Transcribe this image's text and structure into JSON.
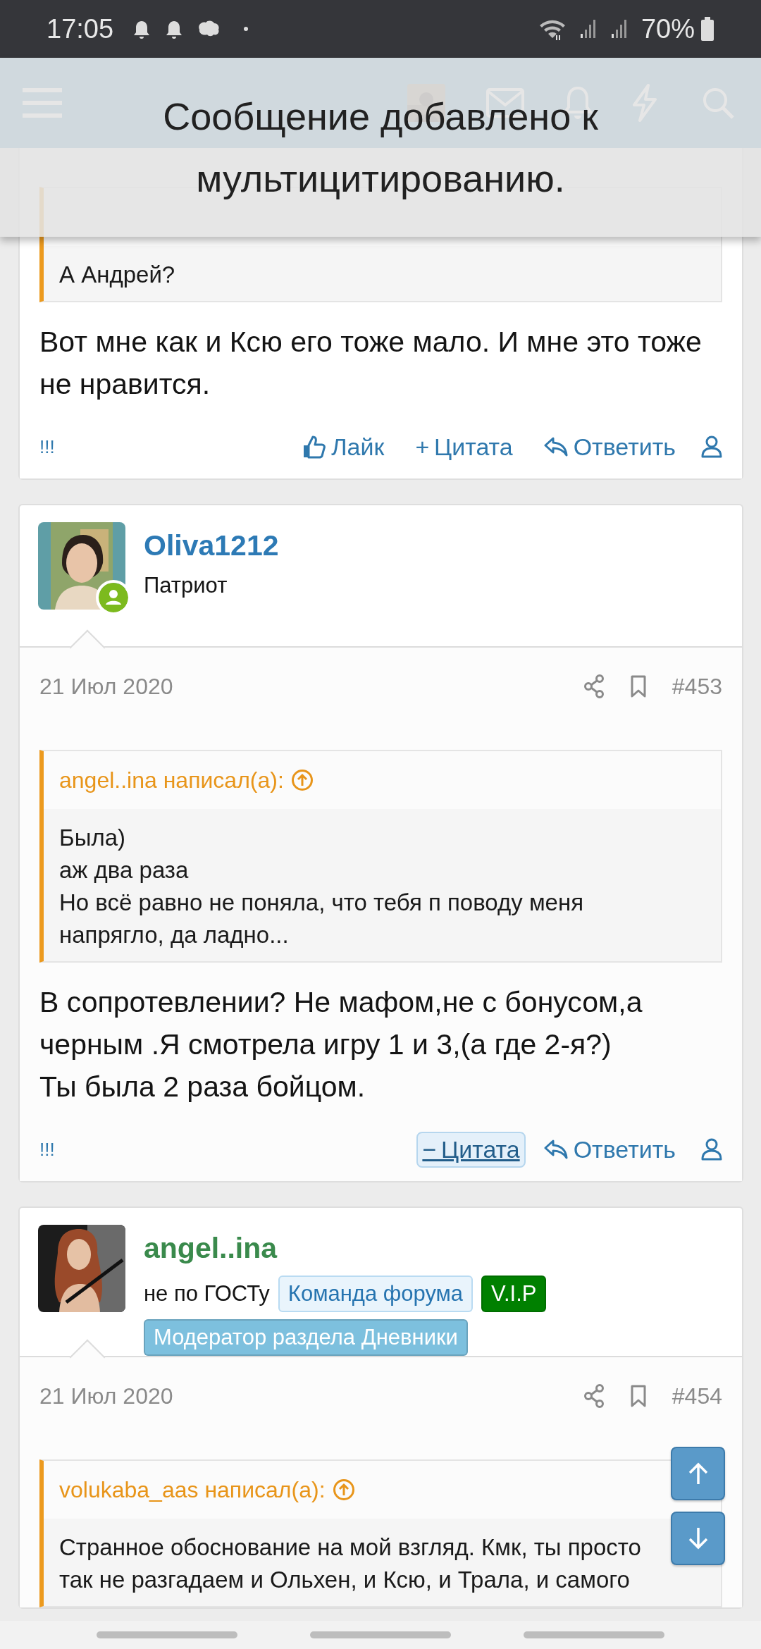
{
  "status_bar": {
    "time": "17:05",
    "battery": "70%"
  },
  "toast": {
    "message": "Сообщение добавлено к мультицитированию."
  },
  "posts": [
    {
      "quote": {
        "text": "А Андрей?"
      },
      "message": "Вот мне как и Ксю его тоже мало. И мне это тоже\nне нравится.",
      "actions": {
        "flag": "!!!",
        "like": "Лайк",
        "quote": {
          "sign": "+",
          "label": "Цитата",
          "selected": false
        },
        "reply": "Ответить"
      }
    },
    {
      "user": {
        "name": "Oliva1212",
        "color": "#2d7ab5",
        "title": "Патриот",
        "online": true
      },
      "date": "21 Июл 2020",
      "number": "#453",
      "quote": {
        "author": "angel..ina написал(а):",
        "text": "Была)\nаж два раза\nНо всё равно не поняла, что тебя п поводу меня\nнапрягло, да ладно..."
      },
      "message": "В сопротевлении? Не мафом,не с бонусом,а\nчерным .Я смотрела игру 1 и 3,(а где 2-я?)\nТы была 2 раза бойцом.",
      "actions": {
        "flag": "!!!",
        "quote": {
          "sign": "−",
          "label": "Цитата",
          "selected": true
        },
        "reply": "Ответить"
      }
    },
    {
      "user": {
        "name": "angel..ina",
        "color": "#3a8a4c",
        "title": "не по ГОСТу",
        "online": false,
        "badges": [
          {
            "label": "Команда форума",
            "kind": "light",
            "color": "#e9f4fc"
          },
          {
            "label": "V.I.P",
            "kind": "solid",
            "color": "#008000"
          },
          {
            "label": "Модератор раздела Дневники",
            "kind": "solid",
            "color": "#7dc0de"
          }
        ]
      },
      "date": "21 Июл 2020",
      "number": "#454",
      "quote": {
        "author": "volukaba_aas написал(а):",
        "text": "Странное обоснование на мой взгляд. Кмк, ты просто\nтак не разгадаем и Ольхен, и Ксю, и Трала, и самого"
      }
    }
  ]
}
